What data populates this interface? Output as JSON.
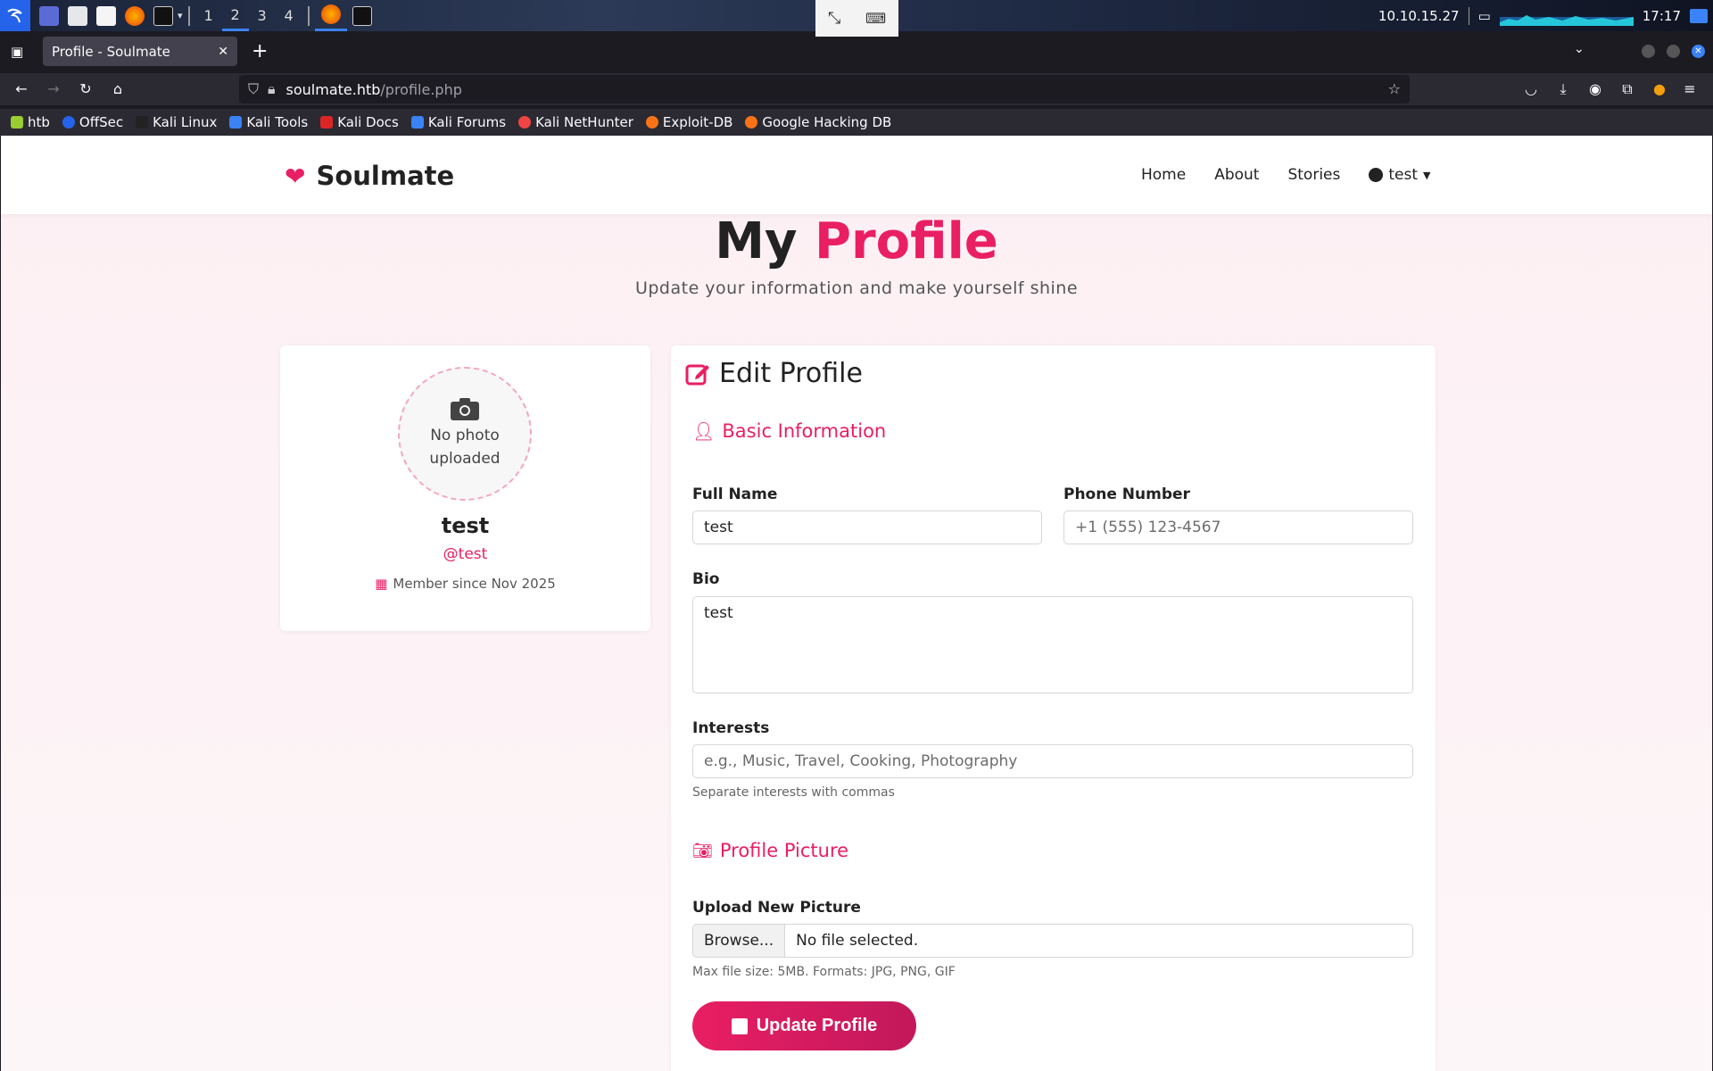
{
  "taskbar": {
    "workspaces": [
      "1",
      "2",
      "3",
      "4"
    ],
    "active_workspace": "2",
    "ip": "10.10.15.27",
    "clock": "17:17"
  },
  "browser": {
    "tab_title": "Profile - Soulmate",
    "url_host": "soulmate.htb",
    "url_path": "/profile.php",
    "bookmarks": [
      "htb",
      "OffSec",
      "Kali Linux",
      "Kali Tools",
      "Kali Docs",
      "Kali Forums",
      "Kali NetHunter",
      "Exploit-DB",
      "Google Hacking DB"
    ]
  },
  "site": {
    "brand": "Soulmate",
    "nav": {
      "home": "Home",
      "about": "About",
      "stories": "Stories",
      "user": "test"
    }
  },
  "hero": {
    "title_plain": "My",
    "title_accent": "Profile",
    "subtitle": "Update your information and make yourself shine"
  },
  "profile_card": {
    "photo_line1": "No photo",
    "photo_line2": "uploaded",
    "name": "test",
    "handle": "@test",
    "member_since": "Member since Nov 2025"
  },
  "form": {
    "title": "Edit Profile",
    "basic_section": "Basic Information",
    "full_name_label": "Full Name",
    "full_name_value": "test",
    "phone_label": "Phone Number",
    "phone_placeholder": "+1 (555) 123-4567",
    "bio_label": "Bio",
    "bio_value": "test",
    "interests_label": "Interests",
    "interests_placeholder": "e.g., Music, Travel, Cooking, Photography",
    "interests_help": "Separate interests with commas",
    "picture_section": "Profile Picture",
    "upload_label": "Upload New Picture",
    "browse_label": "Browse...",
    "no_file": "No file selected.",
    "upload_help": "Max file size: 5MB. Formats: JPG, PNG, GIF",
    "submit_label": "Update Profile"
  },
  "colors": {
    "accent": "#e91e63",
    "accent_dark": "#c2185b"
  }
}
